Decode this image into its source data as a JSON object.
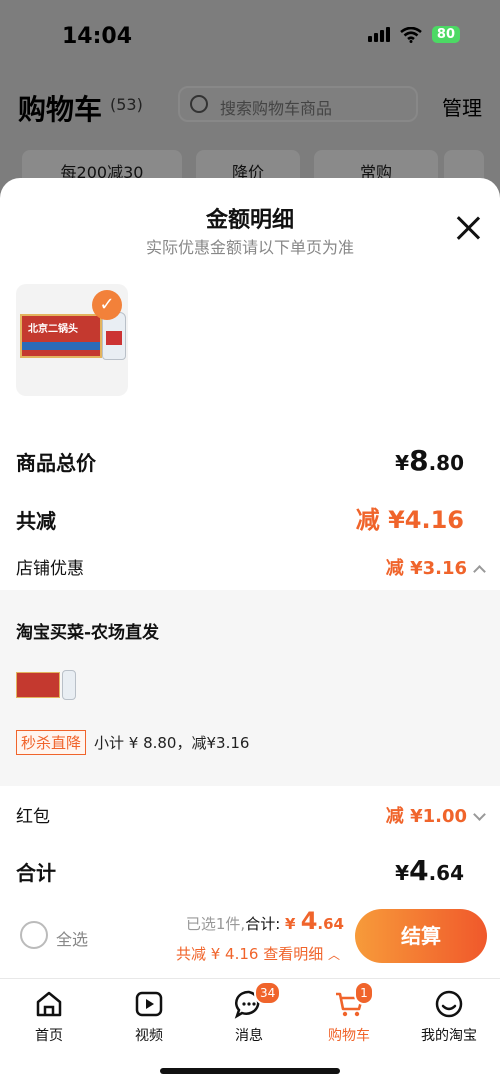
{
  "status_bar": {
    "time": "14:04",
    "battery": "80"
  },
  "background": {
    "title": "购物车",
    "count": "(53)",
    "search_placeholder": "搜索购物车商品",
    "manage": "管理",
    "chips": [
      "每200减30",
      "降价",
      "常购"
    ]
  },
  "sheet": {
    "title": "金额明细",
    "subtitle": "实际优惠金额请以下单页为准",
    "rows": {
      "total_label": "商品总价",
      "total_currency": "¥",
      "total_int": "8",
      "total_dec": ".80",
      "reduce_label": "共减",
      "reduce_value": "减 ¥4.16",
      "store_label": "店铺优惠",
      "store_value": "减 ¥3.16",
      "redpacket_label": "红包",
      "redpacket_value": "减 ¥1.00",
      "sum_label": "合计",
      "sum_currency": "¥",
      "sum_int": "4",
      "sum_dec": ".64"
    },
    "store": {
      "name": "淘宝买菜-农场直发",
      "tag": "秒杀直降",
      "subtotal": "小计 ¥ 8.80，减¥3.16"
    }
  },
  "settle": {
    "select_all": "全选",
    "selected": "已选1件,",
    "sum_key": "合计:",
    "sum_currency": "¥",
    "sum_int": "4",
    "sum_dec": ".64",
    "save_text": "共减 ¥ 4.16  查看明细",
    "pay_button": "结算"
  },
  "tabbar": {
    "home": "首页",
    "video": "视频",
    "messages": "消息",
    "messages_badge": "34",
    "cart": "购物车",
    "cart_badge": "1",
    "mine": "我的淘宝"
  },
  "colors": {
    "accent": "#f0642b",
    "battery": "#4cd964"
  }
}
